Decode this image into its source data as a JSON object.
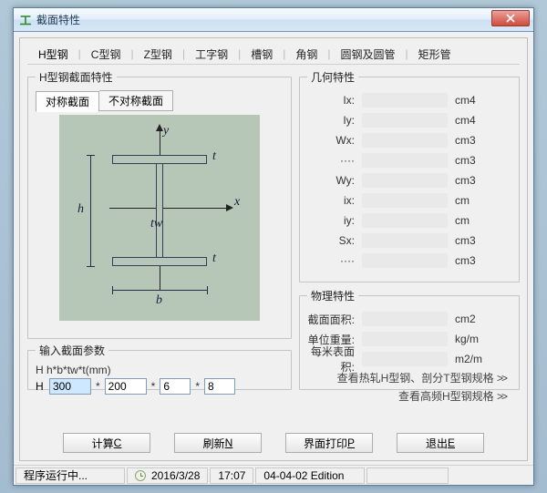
{
  "window": {
    "title": "截面特性"
  },
  "tabs": [
    "H型钢",
    "C型钢",
    "Z型钢",
    "工字钢",
    "槽钢",
    "角钢",
    "圆钢及圆管",
    "矩形管"
  ],
  "section": {
    "group_title": "H型钢截面特性",
    "subtabs": {
      "sym": "对称截面",
      "asym": "不对称截面"
    },
    "labels": {
      "y": "y",
      "x": "x",
      "h": "h",
      "b": "b",
      "t": "t",
      "tw": "tw"
    }
  },
  "param": {
    "group_title": "输入截面参数",
    "hint": "H  h*b*tw*t(mm)",
    "prefix": "H",
    "h": "300",
    "b": "200",
    "tw": "6",
    "t": "8"
  },
  "geom": {
    "group_title": "几何特性",
    "rows": [
      {
        "lbl": "Ix:",
        "unit": "cm4"
      },
      {
        "lbl": "Iy:",
        "unit": "cm4"
      },
      {
        "lbl": "Wx:",
        "unit": "cm3"
      },
      {
        "lbl": "····",
        "unit": "cm3"
      },
      {
        "lbl": "Wy:",
        "unit": "cm3"
      },
      {
        "lbl": "ix:",
        "unit": "cm"
      },
      {
        "lbl": "iy:",
        "unit": "cm"
      },
      {
        "lbl": "Sx:",
        "unit": "cm3"
      },
      {
        "lbl": "····",
        "unit": "cm3"
      }
    ]
  },
  "phys": {
    "group_title": "物理特性",
    "rows": [
      {
        "lbl": "截面面积:",
        "unit": "cm2"
      },
      {
        "lbl": "单位重量:",
        "unit": "kg/m"
      },
      {
        "lbl": "每米表面积:",
        "unit": "m2/m"
      }
    ],
    "link1": "查看热轧H型钢、剖分T型钢规格",
    "link2": "查看高频H型钢规格",
    "chev": ">>"
  },
  "buttons": {
    "calc": "计算",
    "calc_u": "C",
    "refresh": "刷新",
    "refresh_u": "N",
    "print": "界面打印",
    "print_u": "P",
    "exit": "退出",
    "exit_u": "E"
  },
  "status": {
    "running": "程序运行中...",
    "date": "2016/3/28",
    "time": "17:07",
    "edition": "04-04-02 Edition"
  }
}
